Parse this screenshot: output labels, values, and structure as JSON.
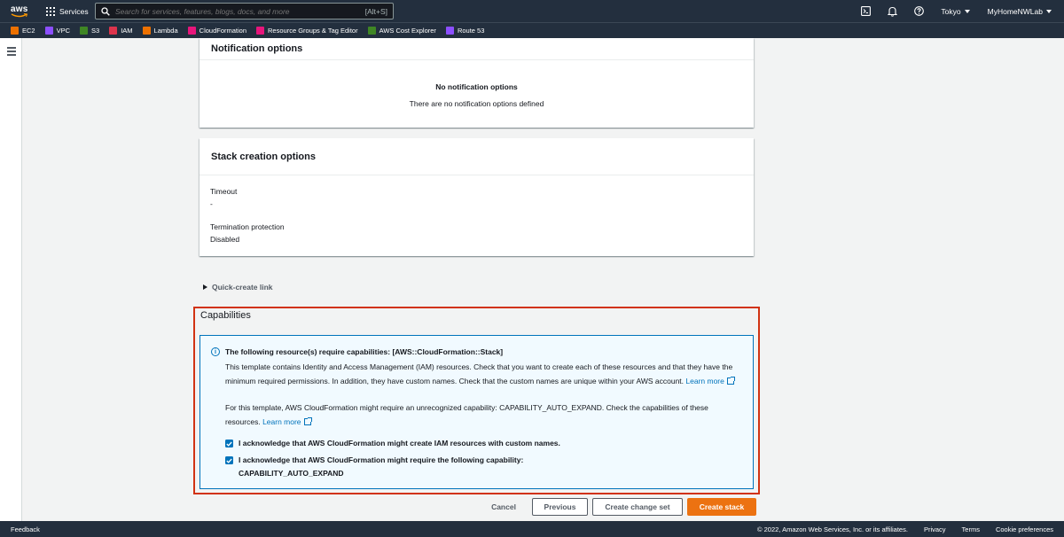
{
  "topnav": {
    "logo_text": "aws",
    "services_label": "Services",
    "search_placeholder": "Search for services, features, blogs, docs, and more",
    "search_shortcut": "[Alt+S]",
    "region": "Tokyo",
    "account": "MyHomeNWLab"
  },
  "favorites": [
    {
      "label": "EC2",
      "color": "#ed7100"
    },
    {
      "label": "VPC",
      "color": "#8c4fff"
    },
    {
      "label": "S3",
      "color": "#3f8624"
    },
    {
      "label": "IAM",
      "color": "#dd344c"
    },
    {
      "label": "Lambda",
      "color": "#ed7100"
    },
    {
      "label": "CloudFormation",
      "color": "#e7157b"
    },
    {
      "label": "Resource Groups & Tag Editor",
      "color": "#e7157b"
    },
    {
      "label": "AWS Cost Explorer",
      "color": "#3f8624"
    },
    {
      "label": "Route 53",
      "color": "#8c4fff"
    }
  ],
  "notification": {
    "title": "Notification options",
    "empty_title": "No notification options",
    "empty_text": "There are no notification options defined"
  },
  "stack_options": {
    "title": "Stack creation options",
    "timeout_label": "Timeout",
    "timeout_value": "-",
    "termination_label": "Termination protection",
    "termination_value": "Disabled"
  },
  "quick_create": "Quick-create link",
  "capabilities": {
    "title": "Capabilities",
    "alert_title": "The following resource(s) require capabilities: [AWS::CloudFormation::Stack]",
    "p1_text": "This template contains Identity and Access Management (IAM) resources. Check that you want to create each of these resources and that they have the minimum required permissions. In addition, they have custom names. Check that the custom names are unique within your AWS account.",
    "p1_link": "Learn more",
    "p2_text": "For this template, AWS CloudFormation might require an unrecognized capability: CAPABILITY_AUTO_EXPAND. Check the capabilities of these resources.",
    "p2_link": "Learn more",
    "ack1": "I acknowledge that AWS CloudFormation might create IAM resources with custom names.",
    "ack1_checked": true,
    "ack2_line1": "I acknowledge that AWS CloudFormation might require the following capability:",
    "ack2_line2": "CAPABILITY_AUTO_EXPAND",
    "ack2_checked": true
  },
  "actions": {
    "cancel": "Cancel",
    "previous": "Previous",
    "change_set": "Create change set",
    "create": "Create stack"
  },
  "footer": {
    "feedback": "Feedback",
    "copyright": "© 2022, Amazon Web Services, Inc. or its affiliates.",
    "privacy": "Privacy",
    "terms": "Terms",
    "cookies": "Cookie preferences"
  }
}
